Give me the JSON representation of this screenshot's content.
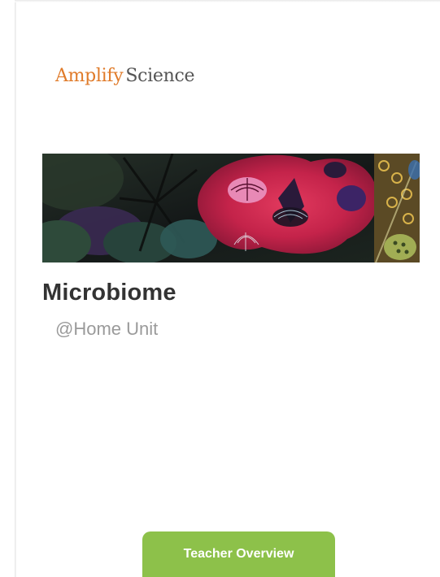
{
  "logo": {
    "brand": "Amplify",
    "product": "Science"
  },
  "banner": {
    "image": "microbiome-illustration"
  },
  "unit": {
    "title": "Microbiome",
    "subtitle": "@Home Unit"
  },
  "actions": {
    "teacher_overview_label": "Teacher Overview"
  },
  "colors": {
    "brand": "#e07b2a",
    "button": "#8dc14a",
    "title": "#333333",
    "subtitle": "#9a9a9a"
  }
}
